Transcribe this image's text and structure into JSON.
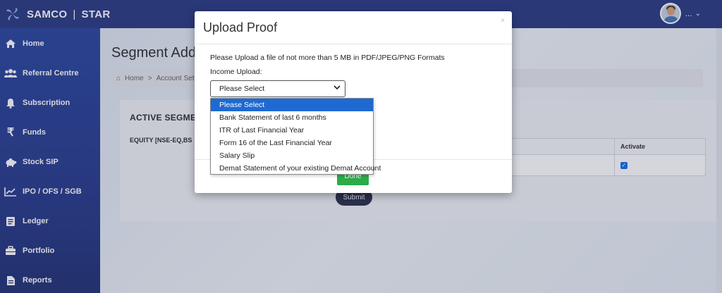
{
  "brand": {
    "name_left": "SAMCO",
    "separator": "|",
    "name_right": "STAR"
  },
  "user": {
    "name": "...",
    "caret": "⌄"
  },
  "sidebar": {
    "items": [
      {
        "label": "Home",
        "icon": "home-icon"
      },
      {
        "label": "Referral Centre",
        "icon": "users-icon"
      },
      {
        "label": "Subscription",
        "icon": "bell-icon"
      },
      {
        "label": "Funds",
        "icon": "rupee-icon"
      },
      {
        "label": "Stock SIP",
        "icon": "piggy-bank-icon"
      },
      {
        "label": "IPO / OFS / SGB",
        "icon": "chart-line-icon"
      },
      {
        "label": "Ledger",
        "icon": "ledger-icon"
      },
      {
        "label": "Portfolio",
        "icon": "briefcase-icon"
      },
      {
        "label": "Reports",
        "icon": "report-icon"
      }
    ]
  },
  "page": {
    "title": "Segment Additi",
    "breadcrumb": {
      "home": "Home",
      "sep": ">",
      "account": "Account Setti"
    },
    "section_title": "ACTIVE SEGMEN",
    "equity_label": "EQUITY [NSE-EQ,BS",
    "table": {
      "activate_header": "Activate"
    },
    "submit_label": "Submit"
  },
  "modal": {
    "title": "Upload Proof",
    "close": "×",
    "message": "Please Upload a file of not more than 5 MB in PDF/JPEG/PNG Formats",
    "income_label": "Income Upload:",
    "select_value": "Please Select",
    "done_label": "Done",
    "options": [
      "Please Select",
      "Bank Statement of last 6 months",
      "ITR of Last Financial Year",
      "Form 16 of the Last Financial Year",
      "Salary Slip",
      "Demat Statement of your existing Demat Account"
    ],
    "selected_option_index": 0
  },
  "colors": {
    "topbar": "#2f3f86",
    "sidebar": "#2c3f8e",
    "highlight": "#1e69d2",
    "done": "#2bab4a",
    "submit": "#2f3550"
  }
}
